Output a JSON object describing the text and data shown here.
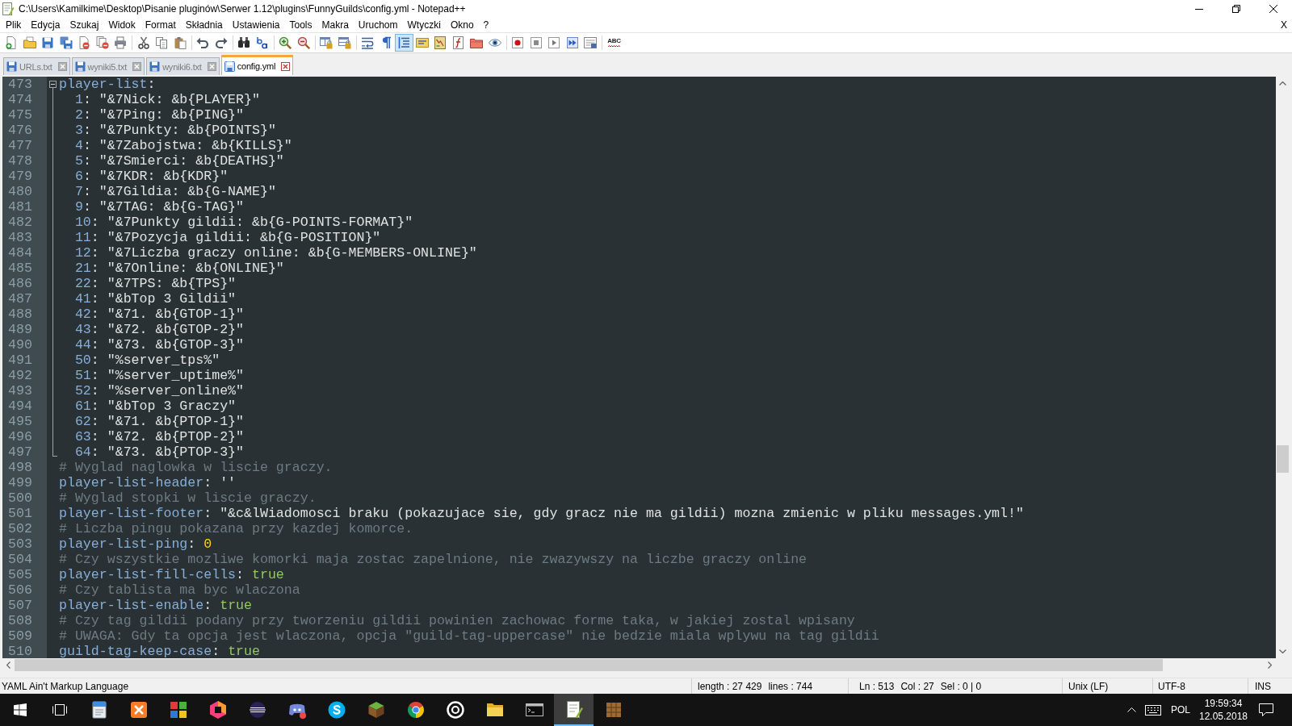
{
  "window": {
    "title": "C:\\Users\\Kamilkime\\Desktop\\Pisanie pluginów\\Serwer 1.12\\plugins\\FunnyGuilds\\config.yml - Notepad++"
  },
  "menu": {
    "items": [
      "Plik",
      "Edycja",
      "Szukaj",
      "Widok",
      "Format",
      "Składnia",
      "Ustawienia",
      "Tools",
      "Makra",
      "Uruchom",
      "Wtyczki",
      "Okno",
      "?"
    ],
    "close_document": "X"
  },
  "toolbar": {
    "groups": [
      [
        {
          "kind": "new",
          "on": false
        },
        {
          "kind": "open",
          "on": false
        },
        {
          "kind": "save",
          "on": false
        },
        {
          "kind": "save-all",
          "on": false
        },
        {
          "kind": "close",
          "on": false
        },
        {
          "kind": "close-all",
          "on": false
        },
        {
          "kind": "print",
          "on": false
        }
      ],
      [
        {
          "kind": "cut",
          "on": false
        },
        {
          "kind": "copy",
          "on": false
        },
        {
          "kind": "paste",
          "on": false
        }
      ],
      [
        {
          "kind": "undo",
          "on": false
        },
        {
          "kind": "redo",
          "on": false
        }
      ],
      [
        {
          "kind": "find",
          "on": false
        },
        {
          "kind": "replace",
          "on": false
        }
      ],
      [
        {
          "kind": "zoom-in",
          "on": false
        },
        {
          "kind": "zoom-out",
          "on": false
        }
      ],
      [
        {
          "kind": "sync-vertical",
          "on": false
        },
        {
          "kind": "sync-horizontal",
          "on": false
        }
      ],
      [
        {
          "kind": "word-wrap",
          "on": false
        },
        {
          "kind": "all-chars",
          "on": false
        },
        {
          "kind": "indent-guide",
          "on": true
        },
        {
          "kind": "user-language",
          "on": false
        },
        {
          "kind": "document-map",
          "on": false
        },
        {
          "kind": "function-list",
          "on": false
        },
        {
          "kind": "folder-workspace",
          "on": false
        },
        {
          "kind": "monitoring",
          "on": false
        }
      ],
      [
        {
          "kind": "record",
          "on": false
        },
        {
          "kind": "stop",
          "on": false
        },
        {
          "kind": "play",
          "on": false
        },
        {
          "kind": "play-multiple",
          "on": false
        },
        {
          "kind": "save-macro",
          "on": false
        }
      ],
      [
        {
          "kind": "spell-check",
          "label": "ABC"
        }
      ]
    ]
  },
  "tabs": [
    {
      "label": "URLs.txt",
      "selected": false
    },
    {
      "label": "wyniki5.txt",
      "selected": false
    },
    {
      "label": "wyniki6.txt",
      "selected": false
    },
    {
      "label": "config.yml",
      "selected": true
    }
  ],
  "editor": {
    "lines": [
      {
        "number": "473",
        "tokens": [
          {
            "kind": "key",
            "text": "player-list"
          },
          {
            "kind": "text",
            "text": ":"
          }
        ],
        "expanded": true,
        "children": [
          {
            "number": "474",
            "tokens": [
              {
                "kind": "key",
                "text": "1"
              },
              {
                "kind": "text",
                "text": ": \"&7Nick: &b{PLAYER}\""
              }
            ]
          },
          {
            "number": "475",
            "tokens": [
              {
                "kind": "key",
                "text": "2"
              },
              {
                "kind": "text",
                "text": ": \"&7Ping: &b{PING}\""
              }
            ]
          },
          {
            "number": "476",
            "tokens": [
              {
                "kind": "key",
                "text": "3"
              },
              {
                "kind": "text",
                "text": ": \"&7Punkty: &b{POINTS}\""
              }
            ]
          },
          {
            "number": "477",
            "tokens": [
              {
                "kind": "key",
                "text": "4"
              },
              {
                "kind": "text",
                "text": ": \"&7Zabojstwa: &b{KILLS}\""
              }
            ]
          },
          {
            "number": "478",
            "tokens": [
              {
                "kind": "key",
                "text": "5"
              },
              {
                "kind": "text",
                "text": ": \"&7Smierci: &b{DEATHS}\""
              }
            ]
          },
          {
            "number": "479",
            "tokens": [
              {
                "kind": "key",
                "text": "6"
              },
              {
                "kind": "text",
                "text": ": \"&7KDR: &b{KDR}\""
              }
            ]
          },
          {
            "number": "480",
            "tokens": [
              {
                "kind": "key",
                "text": "7"
              },
              {
                "kind": "text",
                "text": ": \"&7Gildia: &b{G-NAME}\""
              }
            ]
          },
          {
            "number": "481",
            "tokens": [
              {
                "kind": "key",
                "text": "9"
              },
              {
                "kind": "text",
                "text": ": \"&7TAG: &b{G-TAG}\""
              }
            ]
          },
          {
            "number": "482",
            "tokens": [
              {
                "kind": "key",
                "text": "10"
              },
              {
                "kind": "text",
                "text": ": \"&7Punkty gildii: &b{G-POINTS-FORMAT}\""
              }
            ]
          },
          {
            "number": "483",
            "tokens": [
              {
                "kind": "key",
                "text": "11"
              },
              {
                "kind": "text",
                "text": ": \"&7Pozycja gildii: &b{G-POSITION}\""
              }
            ]
          },
          {
            "number": "484",
            "tokens": [
              {
                "kind": "key",
                "text": "12"
              },
              {
                "kind": "text",
                "text": ": \"&7Liczba graczy online: &b{G-MEMBERS-ONLINE}\""
              }
            ]
          },
          {
            "number": "485",
            "tokens": [
              {
                "kind": "key",
                "text": "21"
              },
              {
                "kind": "text",
                "text": ": \"&7Online: &b{ONLINE}\""
              }
            ]
          },
          {
            "number": "486",
            "tokens": [
              {
                "kind": "key",
                "text": "22"
              },
              {
                "kind": "text",
                "text": ": \"&7TPS: &b{TPS}\""
              }
            ]
          },
          {
            "number": "487",
            "tokens": [
              {
                "kind": "key",
                "text": "41"
              },
              {
                "kind": "text",
                "text": ": \"&bTop 3 Gildii\""
              }
            ]
          },
          {
            "number": "488",
            "tokens": [
              {
                "kind": "key",
                "text": "42"
              },
              {
                "kind": "text",
                "text": ": \"&71. &b{GTOP-1}\""
              }
            ]
          },
          {
            "number": "489",
            "tokens": [
              {
                "kind": "key",
                "text": "43"
              },
              {
                "kind": "text",
                "text": ": \"&72. &b{GTOP-2}\""
              }
            ]
          },
          {
            "number": "490",
            "tokens": [
              {
                "kind": "key",
                "text": "44"
              },
              {
                "kind": "text",
                "text": ": \"&73. &b{GTOP-3}\""
              }
            ]
          },
          {
            "number": "491",
            "tokens": [
              {
                "kind": "key",
                "text": "50"
              },
              {
                "kind": "text",
                "text": ": \"%server_tps%\""
              }
            ]
          },
          {
            "number": "492",
            "tokens": [
              {
                "kind": "key",
                "text": "51"
              },
              {
                "kind": "text",
                "text": ": \"%server_uptime%\""
              }
            ]
          },
          {
            "number": "493",
            "tokens": [
              {
                "kind": "key",
                "text": "52"
              },
              {
                "kind": "text",
                "text": ": \"%server_online%\""
              }
            ]
          },
          {
            "number": "494",
            "tokens": [
              {
                "kind": "key",
                "text": "61"
              },
              {
                "kind": "text",
                "text": ": \"&bTop 3 Graczy\""
              }
            ]
          },
          {
            "number": "495",
            "tokens": [
              {
                "kind": "key",
                "text": "62"
              },
              {
                "kind": "text",
                "text": ": \"&71. &b{PTOP-1}\""
              }
            ]
          },
          {
            "number": "496",
            "tokens": [
              {
                "kind": "key",
                "text": "63"
              },
              {
                "kind": "text",
                "text": ": \"&72. &b{PTOP-2}\""
              }
            ]
          },
          {
            "number": "497",
            "tokens": [
              {
                "kind": "key",
                "text": "64"
              },
              {
                "kind": "text",
                "text": ": \"&73. &b{PTOP-3}\""
              }
            ]
          }
        ]
      },
      {
        "number": "498",
        "tokens": [
          {
            "kind": "comment",
            "text": "# Wyglad naglowka w liscie graczy."
          }
        ]
      },
      {
        "number": "499",
        "tokens": [
          {
            "kind": "key",
            "text": "player-list-header"
          },
          {
            "kind": "text",
            "text": ": ''"
          }
        ]
      },
      {
        "number": "500",
        "tokens": [
          {
            "kind": "comment",
            "text": "# Wyglad stopki w liscie graczy."
          }
        ]
      },
      {
        "number": "501",
        "tokens": [
          {
            "kind": "key",
            "text": "player-list-footer"
          },
          {
            "kind": "text",
            "text": ": \"&c&lWiadomosci braku (pokazujace sie, gdy gracz nie ma gildii) mozna zmienic w pliku messages.yml!\""
          }
        ]
      },
      {
        "number": "502",
        "tokens": [
          {
            "kind": "comment",
            "text": "# Liczba pingu pokazana przy kazdej komorce."
          }
        ]
      },
      {
        "number": "503",
        "tokens": [
          {
            "kind": "key",
            "text": "player-list-ping"
          },
          {
            "kind": "text",
            "text": ": "
          },
          {
            "kind": "number",
            "text": "0"
          }
        ]
      },
      {
        "number": "504",
        "tokens": [
          {
            "kind": "comment",
            "text": "# Czy wszystkie mozliwe komorki maja zostac zapelnione, nie zwazywszy na liczbe graczy online"
          }
        ]
      },
      {
        "number": "505",
        "tokens": [
          {
            "kind": "key",
            "text": "player-list-fill-cells"
          },
          {
            "kind": "text",
            "text": ": "
          },
          {
            "kind": "bool",
            "text": "true"
          }
        ]
      },
      {
        "number": "506",
        "tokens": [
          {
            "kind": "comment",
            "text": "# Czy tablista ma byc wlaczona"
          }
        ]
      },
      {
        "number": "507",
        "tokens": [
          {
            "kind": "key",
            "text": "player-list-enable"
          },
          {
            "kind": "text",
            "text": ": "
          },
          {
            "kind": "bool",
            "text": "true"
          }
        ]
      },
      {
        "number": "508",
        "tokens": [
          {
            "kind": "comment",
            "text": "# Czy tag gildii podany przy tworzeniu gildii powinien zachowac forme taka, w jakiej zostal wpisany"
          }
        ]
      },
      {
        "number": "509",
        "tokens": [
          {
            "kind": "comment",
            "text": "# UWAGA: Gdy ta opcja jest wlaczona, opcja \"guild-tag-uppercase\" nie bedzie miala wplywu na tag gildii"
          }
        ]
      },
      {
        "number": "510",
        "tokens": [
          {
            "kind": "key",
            "text": "guild-tag-keep-case"
          },
          {
            "kind": "text",
            "text": ": "
          },
          {
            "kind": "bool",
            "text": "true"
          }
        ]
      }
    ]
  },
  "status_bar": {
    "language": "YAML Ain't Markup Language",
    "length": "length : 27 429",
    "lines": "lines : 744",
    "line": "Ln : 513",
    "column": "Col : 27",
    "selection": "Sel : 0 | 0",
    "line_endings": "Unix (LF)",
    "encoding": "UTF-8",
    "insert_mode": "INS"
  },
  "taskbar": {
    "apps": [
      {
        "kind": "document",
        "selected": false
      },
      {
        "kind": "cross",
        "selected": false
      },
      {
        "kind": "tiles",
        "selected": false
      },
      {
        "kind": "hexagon",
        "selected": false
      },
      {
        "kind": "planet",
        "selected": false
      },
      {
        "kind": "controller",
        "selected": false
      },
      {
        "kind": "s-logo",
        "selected": false
      },
      {
        "kind": "cube",
        "selected": false
      },
      {
        "kind": "browser",
        "selected": false
      },
      {
        "kind": "target",
        "selected": false
      },
      {
        "kind": "folder",
        "selected": false
      },
      {
        "kind": "terminal",
        "selected": false
      },
      {
        "kind": "notepad",
        "selected": true
      },
      {
        "kind": "crate",
        "selected": false
      }
    ],
    "tray": {
      "language": "POL",
      "time": "19:59:34",
      "date": "12.05.2018"
    }
  }
}
